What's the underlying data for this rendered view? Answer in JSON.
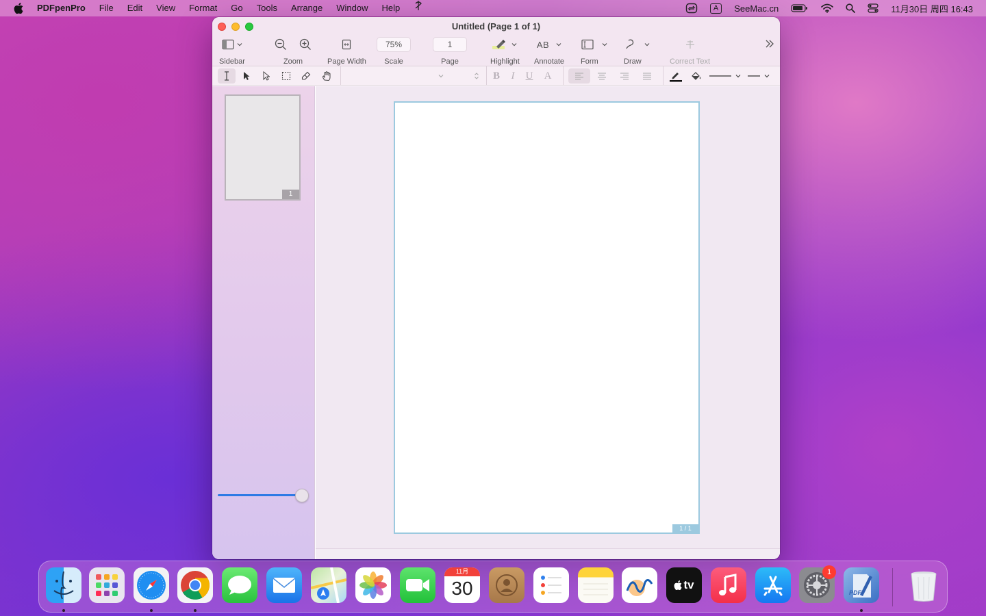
{
  "menubar": {
    "app_name": "PDFpenPro",
    "menus": [
      "File",
      "Edit",
      "View",
      "Format",
      "Go",
      "Tools",
      "Arrange",
      "Window",
      "Help"
    ],
    "right_text": "SeeMac.cn",
    "input_badge": "A",
    "clock": "11月30日 周四  16:43"
  },
  "window": {
    "title": "Untitled (Page 1 of 1)",
    "toolbar": {
      "sidebar_label": "Sidebar",
      "zoom_label": "Zoom",
      "page_width_label": "Page Width",
      "scale_label": "Scale",
      "scale_value": "75%",
      "page_label": "Page",
      "page_value": "1",
      "highlight_label": "Highlight",
      "annotate_label": "Annotate",
      "annotate_icon_text": "AB",
      "form_label": "Form",
      "draw_label": "Draw",
      "correct_text_label": "Correct Text"
    },
    "format_bar": {
      "bold": "B",
      "italic": "I",
      "underline": "U",
      "font_color": "A"
    },
    "sidebar": {
      "thumbnail_page_number": "1"
    },
    "document": {
      "page_indicator": "1 / 1"
    }
  },
  "dock": {
    "calendar_month": "11月",
    "calendar_day": "30",
    "appletv_text": "tv",
    "settings_badge": "1",
    "pdf_label": "PDF"
  },
  "colors": {
    "accent": "#2d7ae5",
    "page_border": "#9cc9df",
    "close": "#fe5f57",
    "minimize": "#febc2e",
    "maximize": "#28c840"
  }
}
